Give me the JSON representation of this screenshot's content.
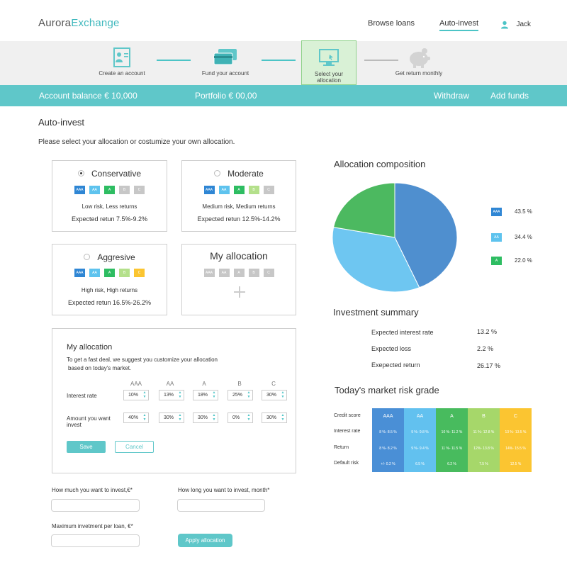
{
  "header": {
    "logo_part1": "Aurora",
    "logo_part2": "Exchange",
    "nav": [
      "Browse loans",
      "Auto-invest"
    ],
    "user": "Jack"
  },
  "steps": [
    {
      "label": "Create an account",
      "icon": "profile-icon"
    },
    {
      "label": "Fund your account",
      "icon": "cards-icon"
    },
    {
      "label": "Select your allocation",
      "icon": "monitor-icon"
    },
    {
      "label": "Get return monthly",
      "icon": "piggy-bank-icon"
    }
  ],
  "balance_bar": {
    "balance": "Account balance  € 10,000",
    "portfolio": "Portfolio € 00,00",
    "withdraw": "Withdraw",
    "add_funds": "Add funds"
  },
  "page": {
    "title": "Auto-invest",
    "subtitle": "Please select your allocation or costumize your own allocation."
  },
  "ratings": [
    "AAA",
    "AA",
    "A",
    "B",
    "C"
  ],
  "cards": [
    {
      "title": "Conservative",
      "risk": "Low risk, Less returns",
      "expected": "Expected retun 7.5%-9.2%",
      "selected": true
    },
    {
      "title": "Moderate",
      "risk": "Medium risk, Medium returns",
      "expected": "Expected retun 12.5%-14.2%",
      "selected": false
    },
    {
      "title": "Aggresive",
      "risk": "High risk, High returns",
      "expected": "Expected retun 16.5%-26.2%",
      "selected": false
    },
    {
      "title": "My allocation"
    }
  ],
  "my_allocation": {
    "title": "My allocation",
    "hint_line1": "To get a fast deal, we suggest you customize your allocation",
    "hint_line2": "based on today's market.",
    "interest_label": "Interest rate",
    "amount_label_1": "Amount you want",
    "amount_label_2": "invest",
    "interest_values": [
      "10%",
      "13%",
      "18%",
      "25%",
      "30%"
    ],
    "amount_values": [
      "40%",
      "30%",
      "30%",
      "0%",
      "30%"
    ],
    "save": "Save",
    "cancel": "Cancel"
  },
  "form": {
    "invest_label": "How much you want to invest,€*",
    "duration_label": "How long you want to invest, month*",
    "max_label": "Maximum invetment per loan, €*",
    "apply": "Apply allocation"
  },
  "allocation_composition": {
    "title": "Allocation composition",
    "legend": [
      {
        "rating": "AAA",
        "value": "43.5 %",
        "color": "#4f8fcf"
      },
      {
        "rating": "AA",
        "value": "34.4 %",
        "color": "#6ec6f1"
      },
      {
        "rating": "A",
        "value": "22.0 %",
        "color": "#4cb960"
      }
    ]
  },
  "investment_summary": {
    "title": "Investment summary",
    "rows": [
      {
        "label": "Expected interest rate",
        "value": "13.2 %"
      },
      {
        "label": "Expected loss",
        "value": "2.2 %"
      },
      {
        "label": "Exepected return",
        "value": "26.17 %"
      }
    ]
  },
  "market_risk": {
    "title": "Today's market risk grade",
    "row_labels": [
      "Credit score",
      "Interest rate",
      "Return",
      "Default risk"
    ],
    "columns": [
      {
        "grade": "AAA",
        "interest": "8 %- 8.5 %",
        "return": "8 %- 8.2 %",
        "default": "+/- 0.2 %",
        "color": "#4a8fd6"
      },
      {
        "grade": "AA",
        "interest": "9 %- 9.8 %",
        "return": "9 %- 9.4 %",
        "default": "6.5 %",
        "color": "#62c1ef"
      },
      {
        "grade": "A",
        "interest": "10 %- 11.2 %",
        "return": "11 %- 11.5 %",
        "default": "6.2 %",
        "color": "#48bb5e"
      },
      {
        "grade": "B",
        "interest": "11 %- 12.8 %",
        "return": "12%- 13.8 %",
        "default": "7.5 %",
        "color": "#a6d76a"
      },
      {
        "grade": "C",
        "interest": "13 %- 13.5 %",
        "return": "14%- 15.5 %",
        "default": "12.5 %",
        "color": "#fbc531"
      }
    ]
  }
}
